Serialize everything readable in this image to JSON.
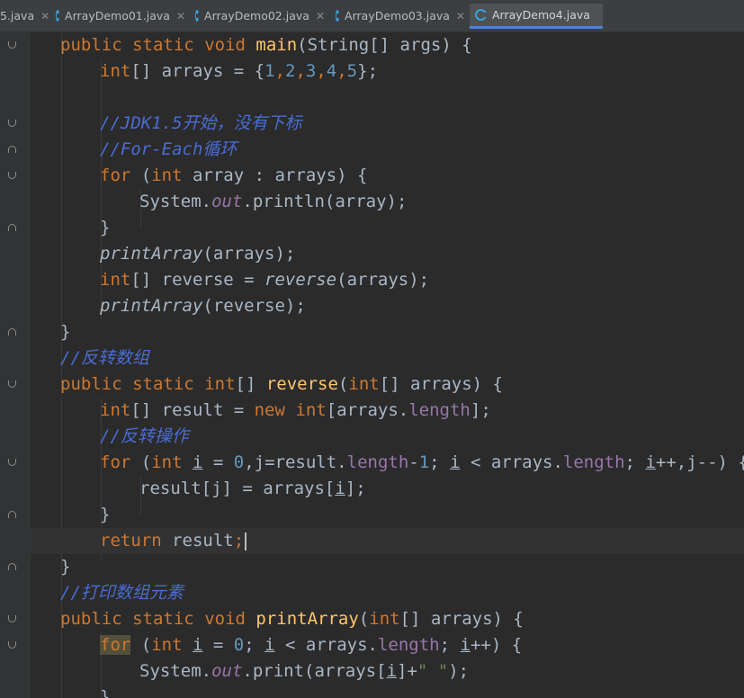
{
  "tabs": [
    {
      "label": "5.java",
      "active": false
    },
    {
      "label": "ArrayDemo01.java",
      "active": false
    },
    {
      "label": "ArrayDemo02.java",
      "active": false
    },
    {
      "label": "ArrayDemo03.java",
      "active": false
    },
    {
      "label": "ArrayDemo4.java",
      "active": true
    }
  ],
  "code": {
    "l1_public": "public",
    "l1_static": "static",
    "l1_void": "void",
    "l1_main": "main",
    "l1_rest": "(String[] args) {",
    "l2_int": "int",
    "l2_rest": "[] arrays = {",
    "l2_n1": "1",
    "l2_n2": "2",
    "l2_n3": "3",
    "l2_n4": "4",
    "l2_n5": "5",
    "l2_end": "};",
    "l4_comment": "//JDK1.5开始，没有下标",
    "l5_comment": "//For-Each循环",
    "l6_for": "for",
    "l6_int": "int",
    "l6_rest": " array : arrays) {",
    "l7_system": "System.",
    "l7_out": "out",
    "l7_rest": ".println(array);",
    "l8": "}",
    "l9_call": "printArray",
    "l9_rest": "(arrays);",
    "l10_int": "int",
    "l10_mid": "[] reverse = ",
    "l10_call": "reverse",
    "l10_rest": "(arrays);",
    "l11_call": "printArray",
    "l11_rest": "(reverse);",
    "l12": "}",
    "l13_comment": "//反转数组",
    "l14_public": "public",
    "l14_static": "static",
    "l14_int": "int",
    "l14_name": "reverse",
    "l14_int2": "int",
    "l14_rest": "[] arrays) {",
    "l15_int": "int",
    "l15_mid": "[] result = ",
    "l15_new": "new",
    "l15_int2": "int",
    "l15_arr": "[arrays.",
    "l15_len": "length",
    "l15_end": "];",
    "l16_comment": "//反转操作",
    "l17_for": "for",
    "l17_int": "int",
    "l17_i": "i",
    "l17_eq": " = ",
    "l17_zero": "0",
    "l17_j": ",j=result.",
    "l17_len": "length",
    "l17_minus": "-",
    "l17_one": "1",
    "l17_semi": "; ",
    "l17_i2": "i",
    "l17_lt": " < arrays.",
    "l17_len2": "length",
    "l17_semi2": "; ",
    "l17_i3": "i",
    "l17_end": "++,j--) {",
    "l18_a": "result[j] = arrays[",
    "l18_i": "i",
    "l18_end": "];",
    "l19": "}",
    "l20_return": "return",
    "l20_rest": " result",
    "l21": "}",
    "l22_comment": "//打印数组元素",
    "l23_public": "public",
    "l23_static": "static",
    "l23_void": "void",
    "l23_name": "printArray",
    "l23_int": "int",
    "l23_rest": "[] arrays) {",
    "l24_for": "for",
    "l24_int": "int",
    "l24_i": "i",
    "l24_eq": " = ",
    "l24_zero": "0",
    "l24_semi": "; ",
    "l24_i2": "i",
    "l24_lt": " < arrays.",
    "l24_len": "length",
    "l24_semi2": "; ",
    "l24_i3": "i",
    "l24_end": "++) {",
    "l25_system": "System.",
    "l25_out": "out",
    "l25_print": ".print(arrays[",
    "l25_i": "i",
    "l25_plus": "]+",
    "l25_str": "\" \"",
    "l25_end": ");",
    "l26": "}"
  }
}
